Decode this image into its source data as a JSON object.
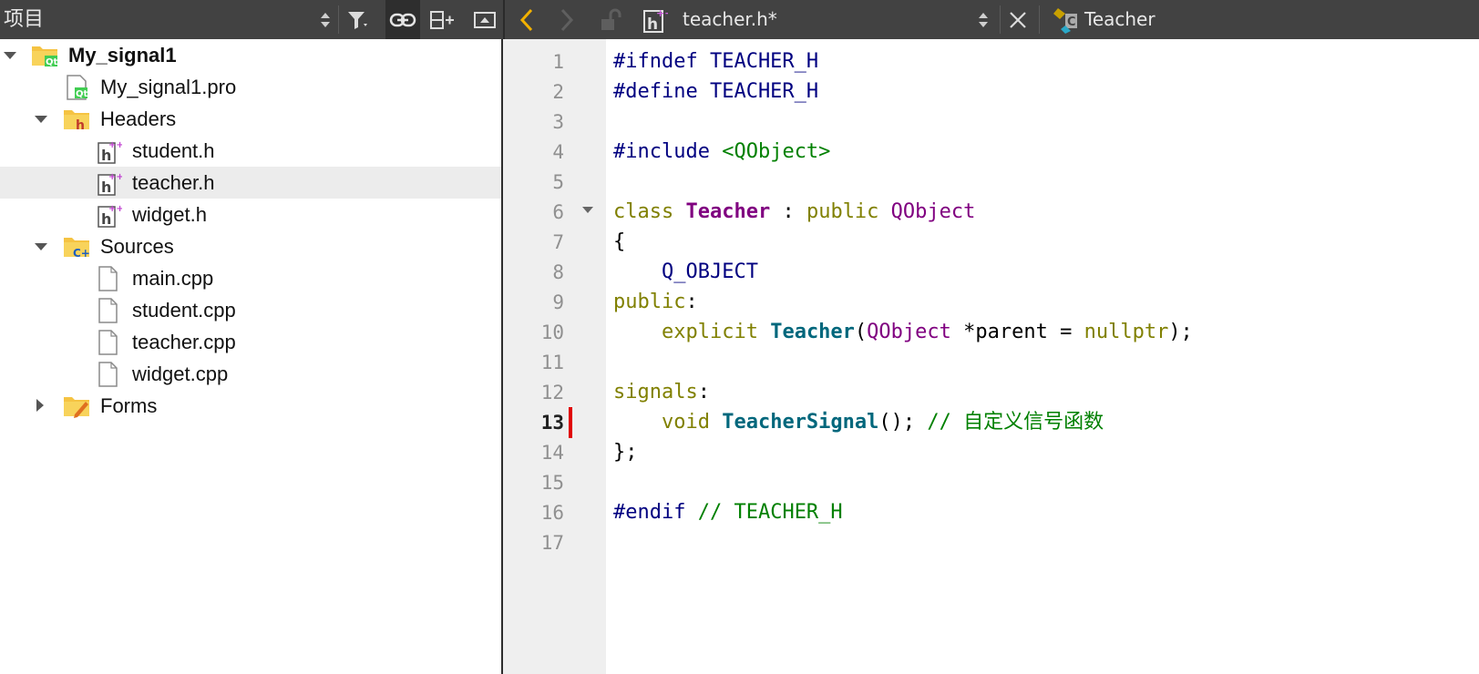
{
  "toolbar": {
    "project_view_title": "项目",
    "file_tab_label": "teacher.h*",
    "symbol_label": "Teacher"
  },
  "project_tree": [
    {
      "label": "My_signal1",
      "icon": "qt-project-folder-icon",
      "expanded": true,
      "bold": true
    },
    {
      "label": "My_signal1.pro",
      "icon": "qt-pro-file-icon"
    },
    {
      "label": "Headers",
      "icon": "headers-folder-icon",
      "expanded": true
    },
    {
      "label": "student.h",
      "icon": "header-file-icon"
    },
    {
      "label": "teacher.h",
      "icon": "header-file-icon",
      "selected": true
    },
    {
      "label": "widget.h",
      "icon": "header-file-icon"
    },
    {
      "label": "Sources",
      "icon": "sources-folder-icon",
      "expanded": true
    },
    {
      "label": "main.cpp",
      "icon": "cpp-file-icon"
    },
    {
      "label": "student.cpp",
      "icon": "cpp-file-icon"
    },
    {
      "label": "teacher.cpp",
      "icon": "cpp-file-icon"
    },
    {
      "label": "widget.cpp",
      "icon": "cpp-file-icon"
    },
    {
      "label": "Forms",
      "icon": "forms-folder-icon",
      "expanded": false
    }
  ],
  "editor": {
    "current_line": 13,
    "line_numbers": [
      "1",
      "2",
      "3",
      "4",
      "5",
      "6",
      "7",
      "8",
      "9",
      "10",
      "11",
      "12",
      "13",
      "14",
      "15",
      "16",
      "17"
    ],
    "code_lines": {
      "l1a": "#ifndef TEACHER_H",
      "l2a": "#define TEACHER_H",
      "l4a": "#include ",
      "l4b": "<QObject>",
      "l6a": "class ",
      "l6b": "Teacher",
      "l6c": " : ",
      "l6d": "public ",
      "l6e": "QObject",
      "l7a": "{",
      "l8a": "    ",
      "l8b": "Q_OBJECT",
      "l9a": "public",
      "l9b": ":",
      "l10a": "    ",
      "l10b": "explicit ",
      "l10c": "Teacher",
      "l10d": "(",
      "l10e": "QObject",
      "l10f": " *parent = ",
      "l10g": "nullptr",
      "l10h": ");",
      "l12a": "signals",
      "l12b": ":",
      "l13a": "    ",
      "l13b": "void ",
      "l13c": "TeacherSignal",
      "l13d": "(); ",
      "l13e": "// 自定义信号函数",
      "l14a": "};",
      "l16a": "#endif",
      "l16b": " // TEACHER_H"
    }
  },
  "colors": {
    "toolbar_bg": "#424242",
    "gutter_bg": "#efefef",
    "preprocessor": "#000080",
    "keyword": "#808000",
    "class_type": "#800080",
    "function": "#00677c",
    "comment": "#008000",
    "change_marker": "#e00000"
  }
}
